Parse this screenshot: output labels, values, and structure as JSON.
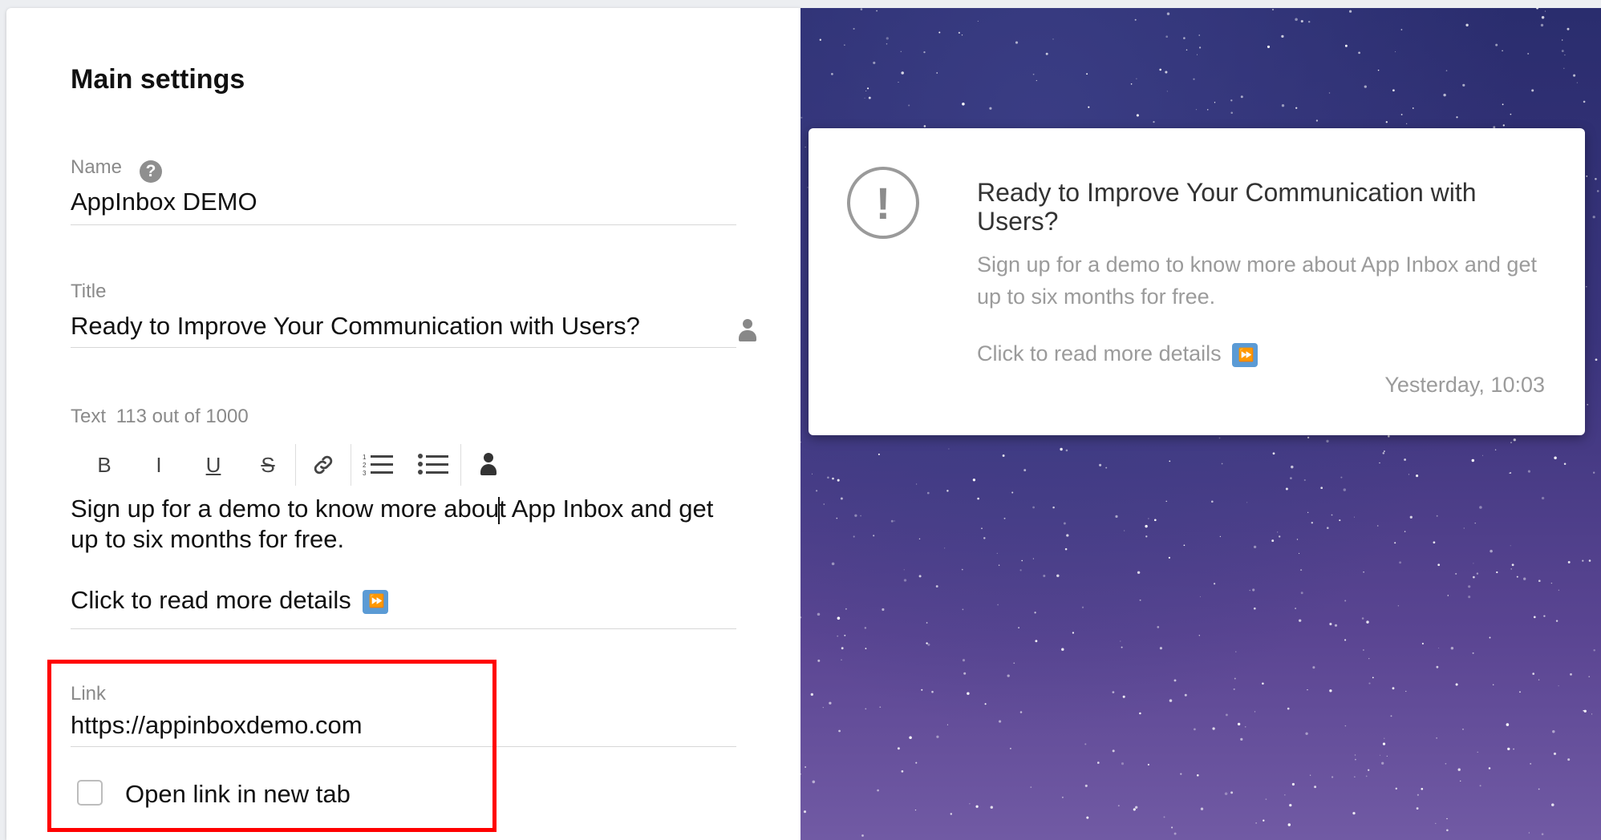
{
  "settings": {
    "heading": "Main settings",
    "name": {
      "label": "Name",
      "help_icon": "?",
      "value": "AppInbox DEMO"
    },
    "title": {
      "label": "Title",
      "value": "Ready to Improve Your Communication with Users?"
    },
    "text": {
      "label": "Text",
      "counter": "113 out of 1000",
      "toolbar": {
        "bold": "B",
        "italic": "I",
        "underline": "U",
        "strike": "S"
      },
      "line1_before": "Sign up for a demo to know more abou",
      "line1_after": "t App Inbox and get up to six months for free.",
      "line2": "Click to read more details",
      "emoji": "⏩"
    },
    "link": {
      "label": "Link",
      "value": "https://appinboxdemo.com",
      "checkbox_label": "Open link in new tab",
      "checked": false
    }
  },
  "preview": {
    "icon": "!",
    "title": "Ready to Improve Your Communication with Users?",
    "text": "Sign up for a demo to know more about App Inbox and get up to six months for free.",
    "link_text": "Click to read more details",
    "emoji": "⏩",
    "timestamp": "Yesterday, 10:03"
  }
}
